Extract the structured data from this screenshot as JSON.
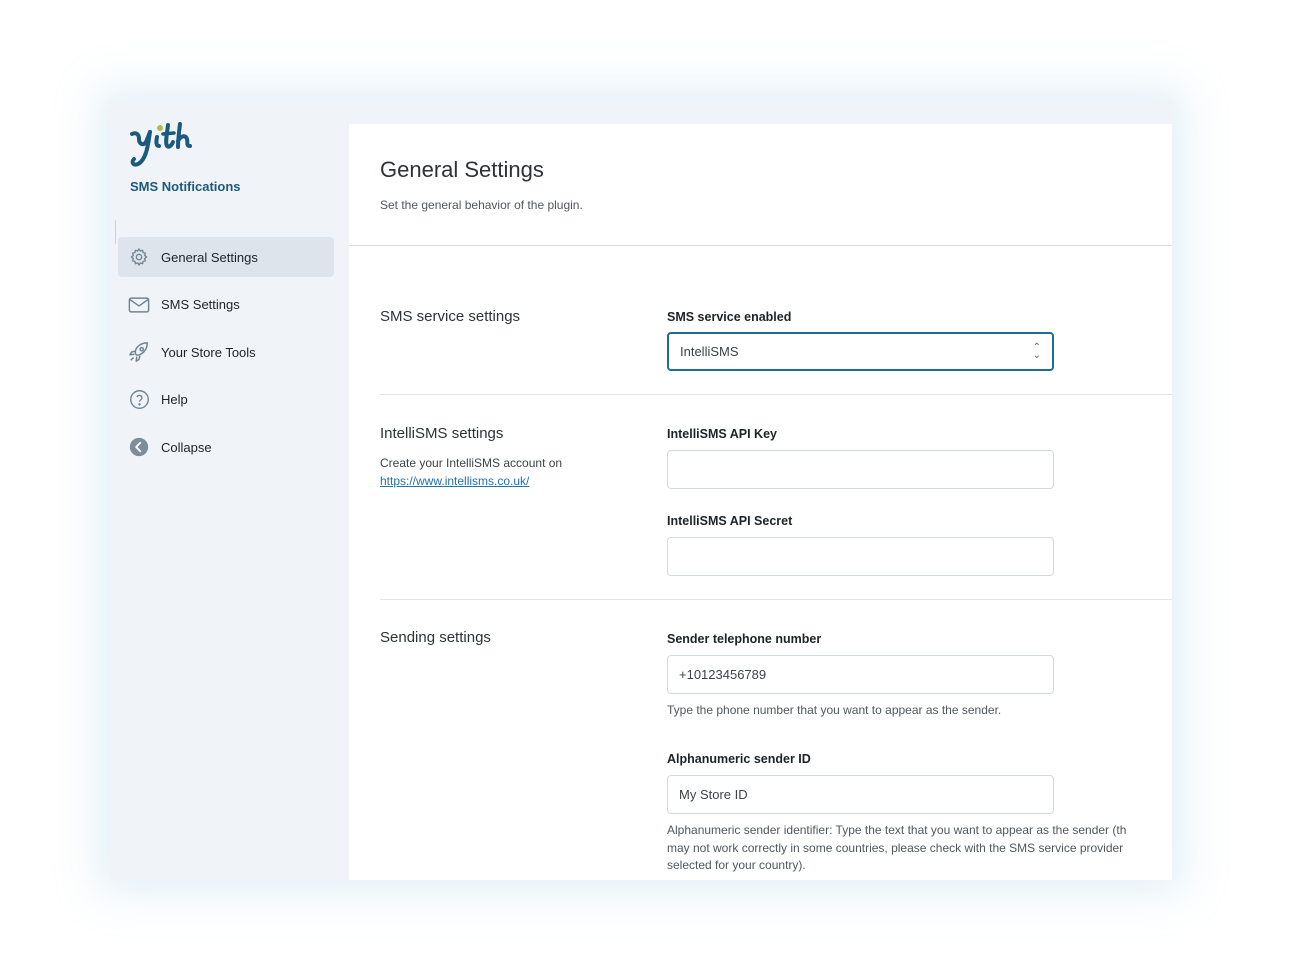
{
  "sidebar": {
    "logo_text": "yith",
    "plugin_name": "SMS Notifications",
    "items": [
      {
        "label": "General Settings",
        "icon": "gear-icon",
        "active": true
      },
      {
        "label": "SMS Settings",
        "icon": "envelope-icon",
        "active": false
      },
      {
        "label": "Your Store Tools",
        "icon": "rocket-icon",
        "active": false
      },
      {
        "label": "Help",
        "icon": "question-circle-icon",
        "active": false
      },
      {
        "label": "Collapse",
        "icon": "collapse-arrow-icon",
        "active": false
      }
    ]
  },
  "page": {
    "title": "General Settings",
    "description": "Set the general behavior of the plugin."
  },
  "sections": {
    "sms_service": {
      "title": "SMS service settings",
      "field_label": "SMS service enabled",
      "selected_value": "IntelliSMS"
    },
    "intellisms": {
      "title": "IntelliSMS settings",
      "description": "Create your IntelliSMS account on",
      "link_text": "https://www.intellisms.co.uk/",
      "api_key_label": "IntelliSMS API Key",
      "api_key_value": "",
      "api_secret_label": "IntelliSMS API Secret",
      "api_secret_value": ""
    },
    "sending": {
      "title": "Sending settings",
      "phone_label": "Sender telephone number",
      "phone_value": "+10123456789",
      "phone_help": "Type the phone number that you want to appear as the sender.",
      "alpha_label": "Alphanumeric sender ID",
      "alpha_value": "My Store ID",
      "alpha_help_1": "Alphanumeric sender identifier: Type the text that you want to appear as the sender (th",
      "alpha_help_2": "may not work correctly in some countries, please check with the SMS service provider",
      "alpha_help_3": "selected for your country)."
    }
  },
  "colors": {
    "brand": "#1a5a7e",
    "brand_accent": "#a6c24a",
    "sidebar_bg": "#f0f4f8",
    "active_item_bg": "#dde4ec",
    "select_border": "#1f6c93",
    "link": "#2271b1"
  }
}
